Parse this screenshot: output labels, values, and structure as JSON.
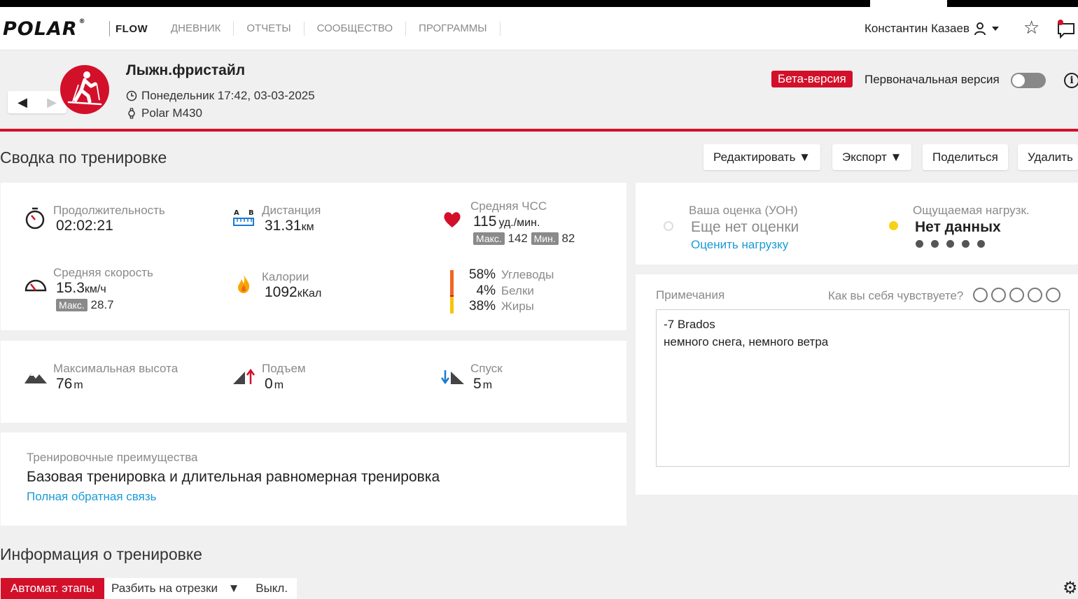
{
  "nav": {
    "logo": "POLAR",
    "product": "FLOW",
    "menu": [
      "ДНЕВНИК",
      "ОТЧЕТЫ",
      "СООБЩЕСТВО",
      "ПРОГРАММЫ"
    ],
    "user_name": "Константин Казаев",
    "icons": [
      "user-icon",
      "chevron-down-icon",
      "star-icon",
      "message-icon"
    ]
  },
  "workout": {
    "sport": "Лыжн.фристайл",
    "datetime": "Понедельник 17:42, 03-03-2025",
    "device": "Polar M430",
    "beta_label": "Бета-версия",
    "original_label": "Первоначальная версия",
    "original_enabled": false
  },
  "summary": {
    "title": "Сводка по тренировке",
    "buttons": {
      "edit": "Редактировать ▼",
      "export": "Экспорт ▼",
      "share": "Поделиться",
      "delete": "Удалить"
    }
  },
  "stats": {
    "duration": {
      "label": "Продолжительность",
      "value": "02:02:21"
    },
    "distance": {
      "label": "Дистанция",
      "value": "31.31",
      "unit": "км"
    },
    "avg_hr": {
      "label": "Средняя ЧСС",
      "value": "115",
      "unit": "уд./мин.",
      "max_label": "Макс.",
      "max": "142",
      "min_label": "Мин.",
      "min": "82"
    },
    "avg_speed": {
      "label": "Средняя скорость",
      "value": "15.3",
      "unit": "км/ч",
      "max_label": "Макс.",
      "max": "28.7"
    },
    "calories": {
      "label": "Калории",
      "value": "1092",
      "unit": "кКал"
    },
    "macros": [
      {
        "pct": "58%",
        "name": "Углеводы",
        "color": "#f26522"
      },
      {
        "pct": "4%",
        "name": "Белки",
        "color": "#d3102a"
      },
      {
        "pct": "38%",
        "name": "Жиры",
        "color": "#f7c600"
      }
    ],
    "max_altitude": {
      "label": "Максимальная высота",
      "value": "76",
      "unit": "m"
    },
    "ascent": {
      "label": "Подъем",
      "value": "0",
      "unit": "m"
    },
    "descent": {
      "label": "Спуск",
      "value": "5",
      "unit": "m"
    }
  },
  "benefit": {
    "label": "Тренировочные преимущества",
    "value": "Базовая тренировка и длительная равномерная тренировка",
    "link": "Полная обратная связь"
  },
  "rating": {
    "rpe_label": "Ваша оценка (УОН)",
    "rpe_value": "Еще нет оценки",
    "rpe_link": "Оценить нагрузку",
    "perceived_label": "Ощущаемая нагрузк.",
    "perceived_value": "Нет данных",
    "dots": 5
  },
  "notes": {
    "label": "Примечания",
    "feeling_label": "Как вы себя чувствуете?",
    "lines": [
      "-7 Brados",
      "немного снега, немного ветра"
    ]
  },
  "info": {
    "title": "Информация о тренировке",
    "auto_laps": "Автомат. этапы",
    "split": "Разбить на отрезки",
    "split_arrow": "▼",
    "off": "Выкл."
  },
  "colors": {
    "brand_red": "#d3102a",
    "link_blue": "#1a9ad6",
    "yellow": "#f7c600"
  }
}
